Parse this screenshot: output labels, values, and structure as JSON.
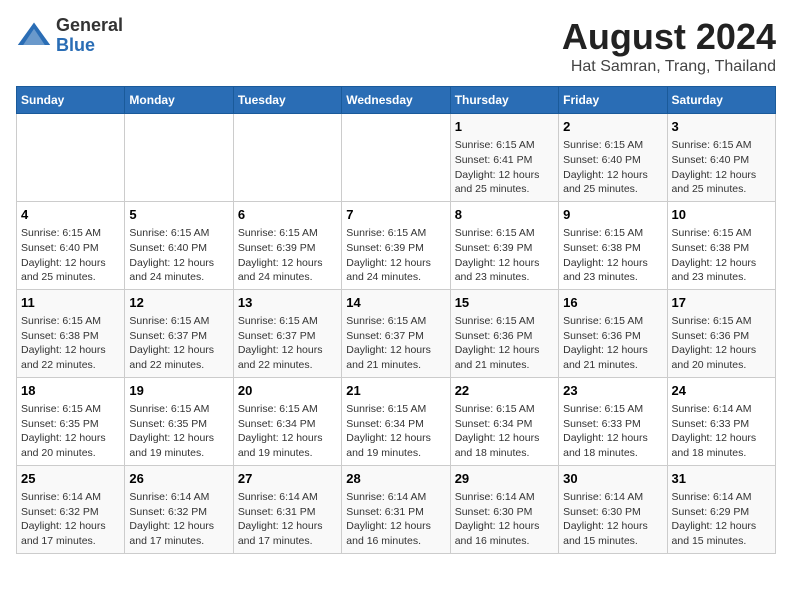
{
  "header": {
    "logo_general": "General",
    "logo_blue": "Blue",
    "title": "August 2024",
    "subtitle": "Hat Samran, Trang, Thailand"
  },
  "days_of_week": [
    "Sunday",
    "Monday",
    "Tuesday",
    "Wednesday",
    "Thursday",
    "Friday",
    "Saturday"
  ],
  "weeks": [
    [
      {
        "day": "",
        "info": ""
      },
      {
        "day": "",
        "info": ""
      },
      {
        "day": "",
        "info": ""
      },
      {
        "day": "",
        "info": ""
      },
      {
        "day": "1",
        "info": "Sunrise: 6:15 AM\nSunset: 6:41 PM\nDaylight: 12 hours\nand 25 minutes."
      },
      {
        "day": "2",
        "info": "Sunrise: 6:15 AM\nSunset: 6:40 PM\nDaylight: 12 hours\nand 25 minutes."
      },
      {
        "day": "3",
        "info": "Sunrise: 6:15 AM\nSunset: 6:40 PM\nDaylight: 12 hours\nand 25 minutes."
      }
    ],
    [
      {
        "day": "4",
        "info": "Sunrise: 6:15 AM\nSunset: 6:40 PM\nDaylight: 12 hours\nand 25 minutes."
      },
      {
        "day": "5",
        "info": "Sunrise: 6:15 AM\nSunset: 6:40 PM\nDaylight: 12 hours\nand 24 minutes."
      },
      {
        "day": "6",
        "info": "Sunrise: 6:15 AM\nSunset: 6:39 PM\nDaylight: 12 hours\nand 24 minutes."
      },
      {
        "day": "7",
        "info": "Sunrise: 6:15 AM\nSunset: 6:39 PM\nDaylight: 12 hours\nand 24 minutes."
      },
      {
        "day": "8",
        "info": "Sunrise: 6:15 AM\nSunset: 6:39 PM\nDaylight: 12 hours\nand 23 minutes."
      },
      {
        "day": "9",
        "info": "Sunrise: 6:15 AM\nSunset: 6:38 PM\nDaylight: 12 hours\nand 23 minutes."
      },
      {
        "day": "10",
        "info": "Sunrise: 6:15 AM\nSunset: 6:38 PM\nDaylight: 12 hours\nand 23 minutes."
      }
    ],
    [
      {
        "day": "11",
        "info": "Sunrise: 6:15 AM\nSunset: 6:38 PM\nDaylight: 12 hours\nand 22 minutes."
      },
      {
        "day": "12",
        "info": "Sunrise: 6:15 AM\nSunset: 6:37 PM\nDaylight: 12 hours\nand 22 minutes."
      },
      {
        "day": "13",
        "info": "Sunrise: 6:15 AM\nSunset: 6:37 PM\nDaylight: 12 hours\nand 22 minutes."
      },
      {
        "day": "14",
        "info": "Sunrise: 6:15 AM\nSunset: 6:37 PM\nDaylight: 12 hours\nand 21 minutes."
      },
      {
        "day": "15",
        "info": "Sunrise: 6:15 AM\nSunset: 6:36 PM\nDaylight: 12 hours\nand 21 minutes."
      },
      {
        "day": "16",
        "info": "Sunrise: 6:15 AM\nSunset: 6:36 PM\nDaylight: 12 hours\nand 21 minutes."
      },
      {
        "day": "17",
        "info": "Sunrise: 6:15 AM\nSunset: 6:36 PM\nDaylight: 12 hours\nand 20 minutes."
      }
    ],
    [
      {
        "day": "18",
        "info": "Sunrise: 6:15 AM\nSunset: 6:35 PM\nDaylight: 12 hours\nand 20 minutes."
      },
      {
        "day": "19",
        "info": "Sunrise: 6:15 AM\nSunset: 6:35 PM\nDaylight: 12 hours\nand 19 minutes."
      },
      {
        "day": "20",
        "info": "Sunrise: 6:15 AM\nSunset: 6:34 PM\nDaylight: 12 hours\nand 19 minutes."
      },
      {
        "day": "21",
        "info": "Sunrise: 6:15 AM\nSunset: 6:34 PM\nDaylight: 12 hours\nand 19 minutes."
      },
      {
        "day": "22",
        "info": "Sunrise: 6:15 AM\nSunset: 6:34 PM\nDaylight: 12 hours\nand 18 minutes."
      },
      {
        "day": "23",
        "info": "Sunrise: 6:15 AM\nSunset: 6:33 PM\nDaylight: 12 hours\nand 18 minutes."
      },
      {
        "day": "24",
        "info": "Sunrise: 6:14 AM\nSunset: 6:33 PM\nDaylight: 12 hours\nand 18 minutes."
      }
    ],
    [
      {
        "day": "25",
        "info": "Sunrise: 6:14 AM\nSunset: 6:32 PM\nDaylight: 12 hours\nand 17 minutes."
      },
      {
        "day": "26",
        "info": "Sunrise: 6:14 AM\nSunset: 6:32 PM\nDaylight: 12 hours\nand 17 minutes."
      },
      {
        "day": "27",
        "info": "Sunrise: 6:14 AM\nSunset: 6:31 PM\nDaylight: 12 hours\nand 17 minutes."
      },
      {
        "day": "28",
        "info": "Sunrise: 6:14 AM\nSunset: 6:31 PM\nDaylight: 12 hours\nand 16 minutes."
      },
      {
        "day": "29",
        "info": "Sunrise: 6:14 AM\nSunset: 6:30 PM\nDaylight: 12 hours\nand 16 minutes."
      },
      {
        "day": "30",
        "info": "Sunrise: 6:14 AM\nSunset: 6:30 PM\nDaylight: 12 hours\nand 15 minutes."
      },
      {
        "day": "31",
        "info": "Sunrise: 6:14 AM\nSunset: 6:29 PM\nDaylight: 12 hours\nand 15 minutes."
      }
    ]
  ]
}
